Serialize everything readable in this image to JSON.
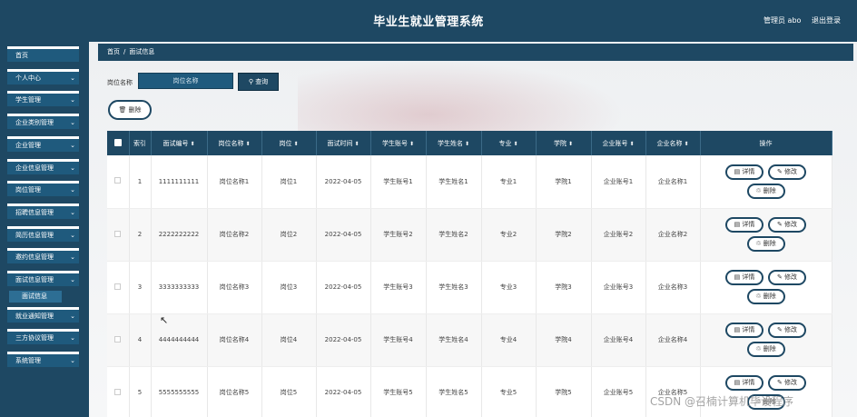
{
  "header": {
    "title": "毕业生就业管理系统",
    "admin": "管理员 abo",
    "logout": "退出登录"
  },
  "sidebar": {
    "items": [
      {
        "label": "首页",
        "has_arrow": false
      },
      {
        "label": "个人中心",
        "has_arrow": true
      },
      {
        "label": "学生管理",
        "has_arrow": true
      },
      {
        "label": "企业类别管理",
        "has_arrow": true
      },
      {
        "label": "企业管理",
        "has_arrow": true
      },
      {
        "label": "企业信息管理",
        "has_arrow": true
      },
      {
        "label": "岗位管理",
        "has_arrow": true
      },
      {
        "label": "招聘信息管理",
        "has_arrow": true
      },
      {
        "label": "简历信息管理",
        "has_arrow": true
      },
      {
        "label": "邀约信息管理",
        "has_arrow": true
      },
      {
        "label": "面试信息管理",
        "has_arrow": true
      },
      {
        "label": "就业通知管理",
        "has_arrow": true
      },
      {
        "label": "三方协议管理",
        "has_arrow": true
      },
      {
        "label": "系统管理",
        "has_arrow": true
      }
    ],
    "subitem": "面试信息"
  },
  "breadcrumb": {
    "home": "首页",
    "separator": "/",
    "current": "面试信息"
  },
  "search": {
    "label": "岗位名称",
    "placeholder": "岗位名称",
    "button": "查询"
  },
  "toolbar": {
    "delete_label": "删除"
  },
  "table": {
    "headers": [
      "索引",
      "面试编号",
      "岗位名称",
      "岗位",
      "面试时间",
      "学生账号",
      "学生姓名",
      "专业",
      "学院",
      "企业账号",
      "企业名称",
      "操作"
    ],
    "sortable": [
      false,
      true,
      true,
      true,
      true,
      true,
      true,
      true,
      true,
      true,
      true,
      false
    ],
    "rows": [
      [
        "1",
        "1111111111",
        "岗位名称1",
        "岗位1",
        "2022-04-05",
        "学生账号1",
        "学生姓名1",
        "专业1",
        "学院1",
        "企业账号1",
        "企业名称1"
      ],
      [
        "2",
        "2222222222",
        "岗位名称2",
        "岗位2",
        "2022-04-05",
        "学生账号2",
        "学生姓名2",
        "专业2",
        "学院2",
        "企业账号2",
        "企业名称2"
      ],
      [
        "3",
        "3333333333",
        "岗位名称3",
        "岗位3",
        "2022-04-05",
        "学生账号3",
        "学生姓名3",
        "专业3",
        "学院3",
        "企业账号3",
        "企业名称3"
      ],
      [
        "4",
        "4444444444",
        "岗位名称4",
        "岗位4",
        "2022-04-05",
        "学生账号4",
        "学生姓名4",
        "专业4",
        "学院4",
        "企业账号4",
        "企业名称4"
      ],
      [
        "5",
        "5555555555",
        "岗位名称5",
        "岗位5",
        "2022-04-05",
        "学生账号5",
        "学生姓名5",
        "专业5",
        "学院5",
        "企业账号5",
        "企业名称5"
      ]
    ],
    "actions": {
      "detail": "详情",
      "edit": "修改",
      "delete": "删除"
    }
  },
  "icons": {
    "chevron": "chevron-down-icon",
    "search": "search-icon",
    "trash": "trash-icon",
    "detail": "document-icon",
    "edit": "pencil-icon"
  },
  "colors": {
    "primary": "#1e4863",
    "menu": "#1f5a7d"
  },
  "watermark": "CSDN @召楠计算机毕设程序"
}
